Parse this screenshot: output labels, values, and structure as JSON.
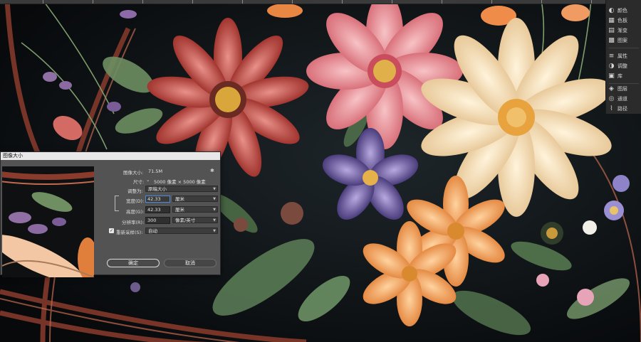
{
  "dialog": {
    "title": "图像大小",
    "image_size_label": "图像大小:",
    "image_size_value": "71.5M",
    "dimensions_label": "尺寸:",
    "dimensions_value": "5000 像素 × 5000 像素",
    "fit_to_label": "调整为:",
    "fit_to_value": "原稿大小",
    "width_label": "宽度(D):",
    "width_value": "42.33",
    "width_unit": "厘米",
    "height_label": "高度(G):",
    "height_value": "42.33",
    "height_unit": "厘米",
    "resolution_label": "分辨率(R):",
    "resolution_value": "300",
    "resolution_unit": "像素/英寸",
    "resample_label": "重新采样(S):",
    "resample_value": "自动",
    "ok_label": "确定",
    "cancel_label": "取消"
  },
  "panels": [
    {
      "label": "颜色",
      "icon": "color-wheel-icon"
    },
    {
      "label": "色板",
      "icon": "swatches-icon"
    },
    {
      "label": "渐变",
      "icon": "gradient-icon"
    },
    {
      "label": "图案",
      "icon": "pattern-icon"
    },
    {
      "label": "属性",
      "icon": "properties-icon"
    },
    {
      "label": "调整",
      "icon": "adjustments-icon"
    },
    {
      "label": "库",
      "icon": "libraries-icon"
    },
    {
      "label": "图层",
      "icon": "layers-icon"
    },
    {
      "label": "通道",
      "icon": "channels-icon"
    },
    {
      "label": "路径",
      "icon": "paths-icon"
    }
  ],
  "colors": {
    "dialog_bg": "#535353",
    "canvas_bg": "#0d0f12",
    "focus": "#4a8ad6"
  }
}
